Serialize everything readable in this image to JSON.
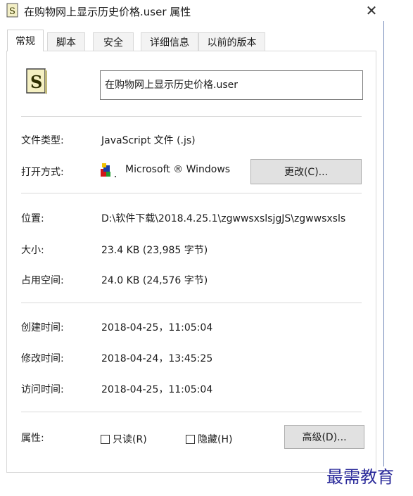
{
  "window": {
    "title": "在购物网上显示历史价格.user 属性",
    "close_glyph": "✕"
  },
  "tabs": [
    {
      "label": "常规",
      "active": true
    },
    {
      "label": "脚本",
      "active": false
    },
    {
      "label": "安全",
      "active": false
    },
    {
      "label": "详细信息",
      "active": false
    },
    {
      "label": "以前的版本",
      "active": false
    }
  ],
  "general": {
    "file_name": "在购物网上显示历史价格.user",
    "file_type_label": "文件类型:",
    "file_type_value": "JavaScript 文件 (.js)",
    "open_with_label": "打开方式:",
    "open_with_value": "Microsoft ® Windows",
    "change_button": "更改(C)...",
    "location_label": "位置:",
    "location_value": "D:\\软件下载\\2018.4.25.1\\zgwwsxslsjgJS\\zgwwsxsls",
    "size_label": "大小:",
    "size_value": "23.4 KB (23,985 字节)",
    "disk_size_label": "占用空间:",
    "disk_size_value": "24.0 KB (24,576 字节)",
    "created_label": "创建时间:",
    "created_value": "2018-04-25，11:05:04",
    "modified_label": "修改时间:",
    "modified_value": "2018-04-24，13:45:25",
    "accessed_label": "访问时间:",
    "accessed_value": "2018-04-25，11:05:04",
    "attributes_label": "属性:",
    "readonly_label": "只读(R)",
    "hidden_label": "隐藏(H)",
    "advanced_button": "高级(D)..."
  },
  "watermark": "最需教育"
}
